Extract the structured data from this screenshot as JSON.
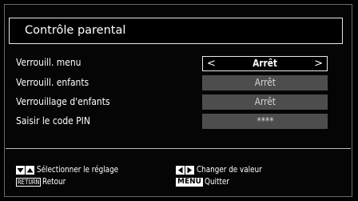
{
  "menu": {
    "title": "Contrôle parental",
    "items": [
      {
        "label": "Verrouill. menu",
        "value": "Arrêt",
        "selected": true,
        "left_arrow": "<",
        "right_arrow": ">"
      },
      {
        "label": "Verrouill. enfants",
        "value": "Arrêt",
        "selected": false
      },
      {
        "label": "Verrouillage d'enfants",
        "value": "Arrêt",
        "selected": false
      },
      {
        "label": "Saisir le code PIN",
        "value": "****",
        "selected": false
      }
    ]
  },
  "help": {
    "select": {
      "keys": [
        "down-triangle-icon",
        "up-triangle-icon"
      ],
      "text": "Sélectionner le réglage"
    },
    "back": {
      "key": "RETURN",
      "text": "Retour"
    },
    "change": {
      "keys": [
        "left-triangle-icon",
        "right-triangle-icon"
      ],
      "text": "Changer de valeur"
    },
    "quit": {
      "key": "MENU",
      "text": "Quitter"
    }
  }
}
